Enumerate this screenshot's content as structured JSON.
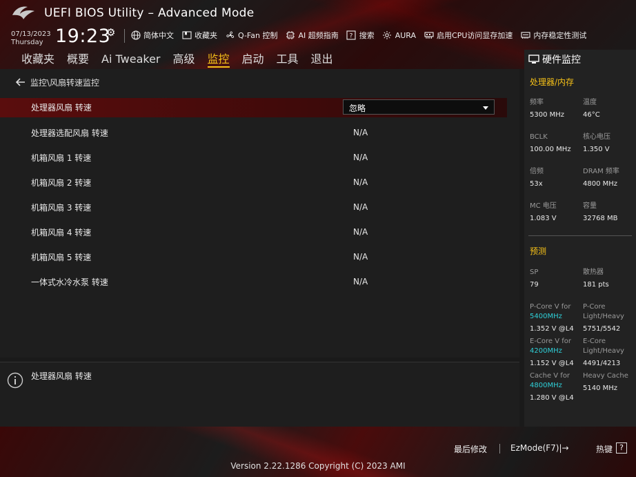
{
  "app": {
    "title": "UEFI BIOS Utility – Advanced Mode"
  },
  "clock": {
    "date": "07/13/2023",
    "day": "Thursday",
    "time": "19:23"
  },
  "toolbar": [
    {
      "icon": "globe-icon",
      "label": "简体中文"
    },
    {
      "icon": "bookmark-icon",
      "label": "收藏夹"
    },
    {
      "icon": "fan-icon",
      "label": "Q-Fan 控制"
    },
    {
      "icon": "ai-chip-icon",
      "label": "AI 超频指南"
    },
    {
      "icon": "help-search-icon",
      "label": "搜索"
    },
    {
      "icon": "aura-icon",
      "label": "AURA"
    },
    {
      "icon": "memory-icon",
      "label": "启用CPU访问显存加速"
    },
    {
      "icon": "memtest-icon",
      "label": "内存稳定性测试"
    }
  ],
  "tabs": [
    {
      "label": "收藏夹",
      "active": false
    },
    {
      "label": "概要",
      "active": false
    },
    {
      "label": "Ai Tweaker",
      "active": false
    },
    {
      "label": "高级",
      "active": false
    },
    {
      "label": "监控",
      "active": true
    },
    {
      "label": "启动",
      "active": false
    },
    {
      "label": "工具",
      "active": false
    },
    {
      "label": "退出",
      "active": false
    }
  ],
  "breadcrumb": "监控\\风扇转速监控",
  "settings": [
    {
      "label": "处理器风扇 转速",
      "value": "忽略",
      "type": "dropdown",
      "selected": true
    },
    {
      "label": "处理器选配风扇 转速",
      "value": "N/A",
      "type": "text"
    },
    {
      "label": "机箱风扇 1 转速",
      "value": "N/A",
      "type": "text"
    },
    {
      "label": "机箱风扇 2 转速",
      "value": "N/A",
      "type": "text"
    },
    {
      "label": "机箱风扇 3 转速",
      "value": "N/A",
      "type": "text"
    },
    {
      "label": "机箱风扇 4 转速",
      "value": "N/A",
      "type": "text"
    },
    {
      "label": "机箱风扇 5 转速",
      "value": "N/A",
      "type": "text"
    },
    {
      "label": "一体式水冷水泵 转速",
      "value": "N/A",
      "type": "text"
    }
  ],
  "help": {
    "text": "处理器风扇 转速"
  },
  "sidebar": {
    "title": "硬件监控",
    "cpu_mem_section": "处理器/内存",
    "cpu_mem": [
      {
        "label": "频率",
        "value": "5300 MHz"
      },
      {
        "label": "温度",
        "value": "46°C"
      },
      {
        "label": "BCLK",
        "value": "100.00 MHz"
      },
      {
        "label": "核心电压",
        "value": "1.350 V"
      },
      {
        "label": "倍频",
        "value": "53x"
      },
      {
        "label": "DRAM 频率",
        "value": "4800 MHz"
      },
      {
        "label": "MC 电压",
        "value": "1.083 V"
      },
      {
        "label": "容量",
        "value": "32768 MB"
      }
    ],
    "predict_section": "预测",
    "predict_basic": [
      {
        "label": "SP",
        "value": "79"
      },
      {
        "label": "散热器",
        "value": "181 pts"
      }
    ],
    "predict_detail": [
      {
        "label1": "P-Core V for",
        "highlight": "5400MHz",
        "value": "1.352 V @L4",
        "label2a": "P-Core",
        "label2b": "Light/Heavy",
        "value2": "5751/5542"
      },
      {
        "label1": "E-Core V for",
        "highlight": "4200MHz",
        "value": "1.152 V @L4",
        "label2a": "E-Core",
        "label2b": "Light/Heavy",
        "value2": "4491/4213"
      },
      {
        "label1": "Cache V for",
        "highlight": "4800MHz",
        "value": "1.280 V @L4",
        "label2a": "Heavy Cache",
        "label2b": "",
        "value2": "5140 MHz"
      }
    ]
  },
  "footer": {
    "last_modified": "最后修改",
    "ezmode": "EzMode(F7)|→",
    "hotkey": "热键",
    "hotkey_key": "?",
    "version": "Version 2.22.1286 Copyright (C) 2023 AMI"
  },
  "colors": {
    "accent": "#f5c018",
    "highlight": "#2fd0d8",
    "selected_row": "#5a0d0d"
  }
}
